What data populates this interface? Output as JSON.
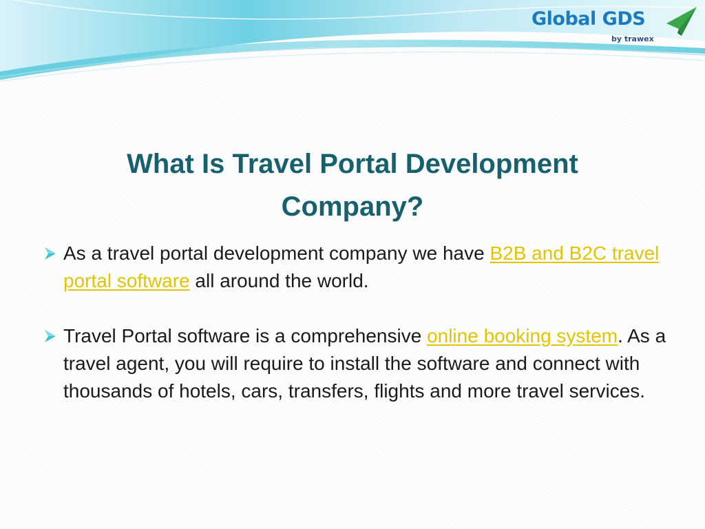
{
  "logo": {
    "name": "Global GDS",
    "tagline": "by trawex",
    "icon": "paper-plane-icon"
  },
  "title": "What Is Travel Portal Development Company?",
  "bullets": [
    {
      "icon": "arrow-bullet-icon",
      "text_before": "As a travel portal development company we have ",
      "link": "B2B and B2C travel portal software",
      "text_after": " all around the world."
    },
    {
      "icon": "arrow-bullet-icon",
      "text_before": "Travel Portal software is a comprehensive ",
      "link": "online booking system",
      "text_after": ". As a travel agent, you will require to install the software and connect with thousands of hotels, cars, transfers, flights and more travel services."
    }
  ],
  "colors": {
    "title": "#17616f",
    "link": "#e2c400",
    "accent": "#3ec1d6",
    "logo": "#1b7ac0"
  }
}
